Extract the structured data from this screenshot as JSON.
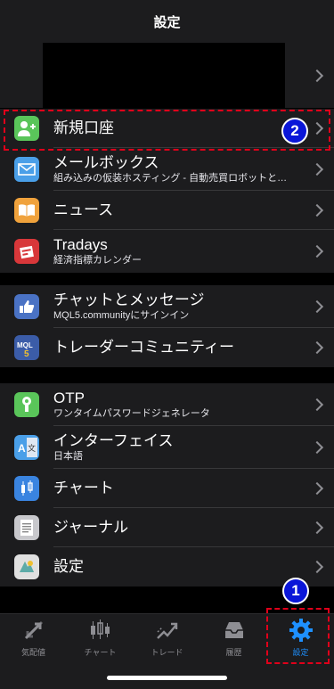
{
  "header": {
    "title": "設定"
  },
  "group1": [
    {
      "label": "新規口座",
      "sub": "",
      "icon": "add-user-icon",
      "color": "#5ac55a"
    },
    {
      "label": "メールボックス",
      "sub": "組み込みの仮装ホスティング - 自動売買ロボットと…",
      "icon": "mail-icon",
      "color": "#4a9fe8"
    },
    {
      "label": "ニュース",
      "sub": "",
      "icon": "book-icon",
      "color": "#f0a23c"
    },
    {
      "label": "Tradays",
      "sub": "経済指標カレンダー",
      "icon": "calendar-icon",
      "color": "#d8373a"
    }
  ],
  "group2": [
    {
      "label": "チャットとメッセージ",
      "sub": "MQL5.communityにサインイン",
      "icon": "hand-point-icon",
      "color": "#4a72c4"
    },
    {
      "label": "トレーダーコミュニティー",
      "sub": "",
      "icon": "mql5-icon",
      "color": "#3b5ca8"
    }
  ],
  "group3": [
    {
      "label": "OTP",
      "sub": "ワンタイムパスワードジェネレータ",
      "icon": "key-icon",
      "color": "#5ac55a"
    },
    {
      "label": "インターフェイス",
      "sub": "日本語",
      "icon": "translate-icon",
      "color": "#4a9fe8"
    },
    {
      "label": "チャート",
      "sub": "",
      "icon": "candlestick-icon",
      "color": "#3a84e0"
    },
    {
      "label": "ジャーナル",
      "sub": "",
      "icon": "journal-icon",
      "color": "#c8c8cc"
    },
    {
      "label": "設定",
      "sub": "",
      "icon": "settings-app-icon",
      "color": "#e0e0e0"
    }
  ],
  "badges": {
    "one": "1",
    "two": "2"
  },
  "tabbar": [
    {
      "label": "気配値",
      "icon": "quotes-icon"
    },
    {
      "label": "チャート",
      "icon": "chart-tab-icon"
    },
    {
      "label": "トレード",
      "icon": "trade-icon"
    },
    {
      "label": "履歴",
      "icon": "history-icon"
    },
    {
      "label": "設定",
      "icon": "gear-icon",
      "active": true
    }
  ],
  "colors": {
    "accent": "#1e90ff",
    "highlight": "#e0001a",
    "badge": "#0a16d8"
  }
}
